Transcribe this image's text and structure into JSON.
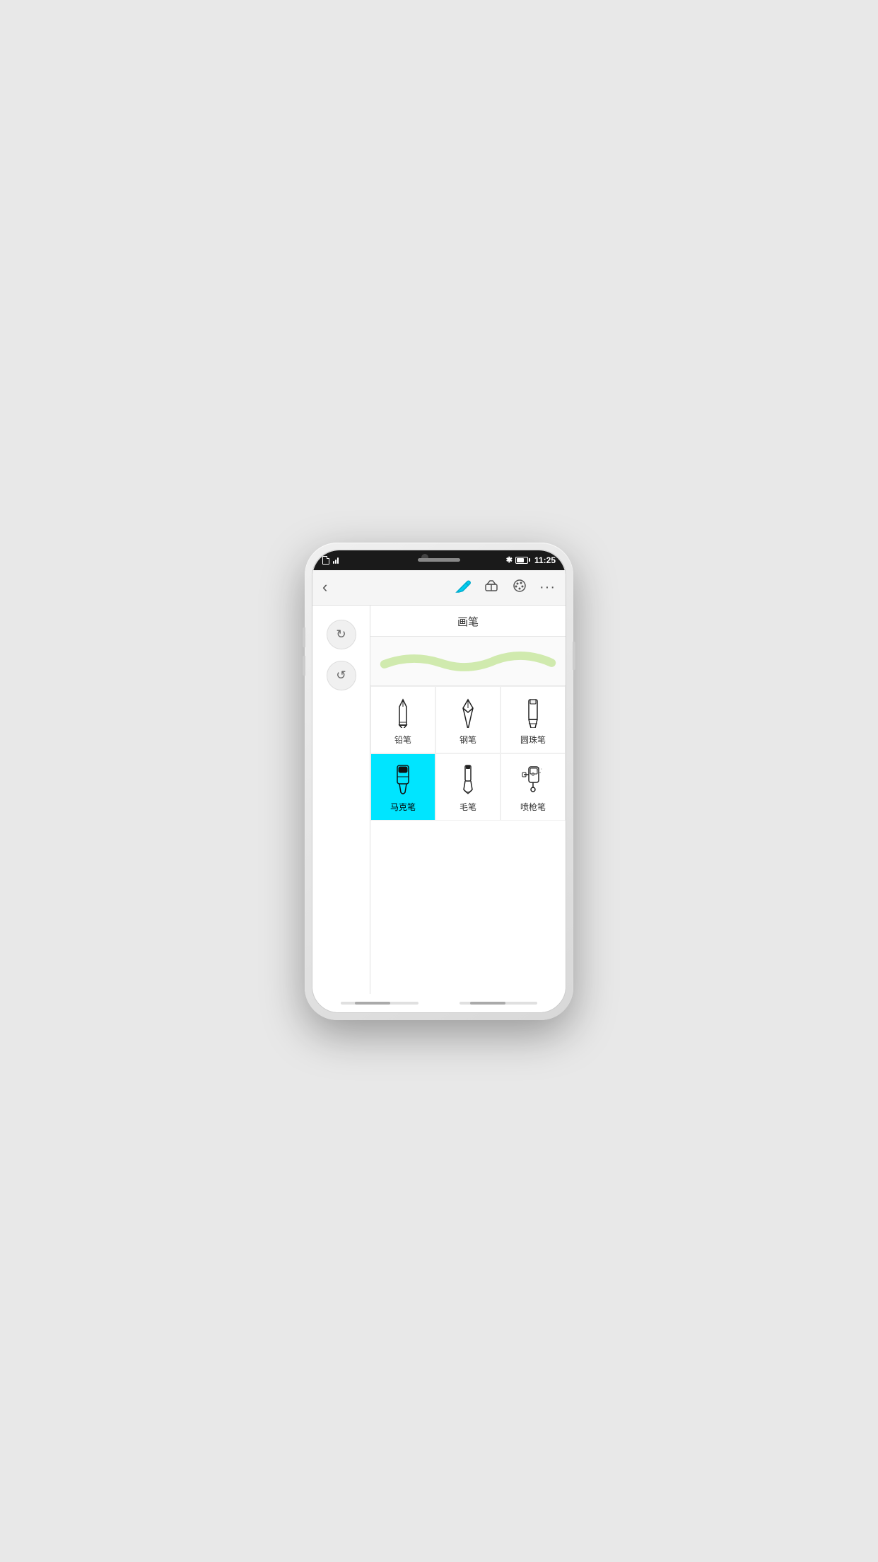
{
  "statusBar": {
    "time": "11:25",
    "icons": [
      "document",
      "wifi",
      "bluetooth",
      "battery"
    ]
  },
  "toolbar": {
    "backLabel": "‹",
    "tools": [
      {
        "name": "pen-tool",
        "label": "画笔"
      },
      {
        "name": "eraser-tool",
        "label": "橡皮擦"
      },
      {
        "name": "palette-tool",
        "label": "调色板"
      },
      {
        "name": "more-tool",
        "label": "···"
      }
    ]
  },
  "sideButtons": [
    {
      "name": "redo-button",
      "label": "↻"
    },
    {
      "name": "undo-button",
      "label": "↺"
    }
  ],
  "brushPanel": {
    "title": "画笔",
    "brushes": [
      {
        "id": "pencil",
        "label": "铅笔",
        "active": false
      },
      {
        "id": "fountain-pen",
        "label": "钢笔",
        "active": false
      },
      {
        "id": "ballpoint",
        "label": "圆珠笔",
        "active": false
      },
      {
        "id": "marker",
        "label": "马克笔",
        "active": true
      },
      {
        "id": "brush",
        "label": "毛笔",
        "active": false
      },
      {
        "id": "spray",
        "label": "喷枪笔",
        "active": false
      }
    ]
  },
  "bottomScrollbars": {
    "leftThumbPosition": 20,
    "rightThumbPosition": 15
  },
  "colors": {
    "activeBackground": "#00e5ff",
    "previewStroke": "#c8e6a0",
    "toolbarBackground": "#f5f5f5",
    "statusBarBackground": "#1a1a1a"
  }
}
